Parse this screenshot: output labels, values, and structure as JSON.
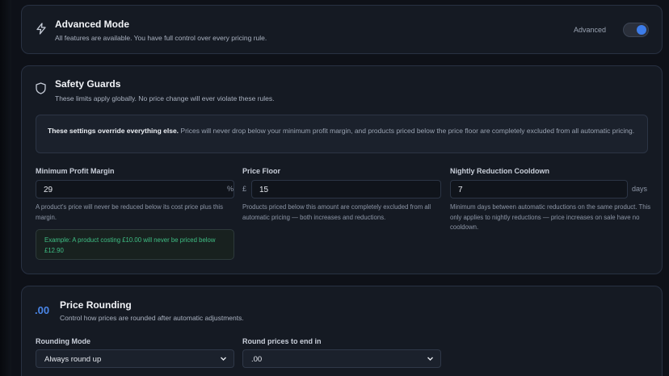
{
  "advanced": {
    "title": "Advanced Mode",
    "description": "All features are available. You have full control over every pricing rule.",
    "toggle_label": "Advanced",
    "toggle_on": true,
    "icon": "lightning-icon"
  },
  "safety": {
    "title": "Safety Guards",
    "description": "These limits apply globally. No price change will ever violate these rules.",
    "icon": "shield-icon",
    "notice_bold": "These settings override everything else.",
    "notice_text": " Prices will never drop below your minimum profit margin, and products priced below the price floor are completely excluded from all automatic pricing.",
    "fields": {
      "min_margin": {
        "label": "Minimum Profit Margin",
        "value": "29",
        "unit": "%",
        "help": "A product's price will never be reduced below its cost price plus this margin."
      },
      "price_floor": {
        "label": "Price Floor",
        "value": "15",
        "prefix": "£",
        "help": "Products priced below this amount are completely excluded from all automatic pricing — both increases and reductions."
      },
      "cooldown": {
        "label": "Nightly Reduction Cooldown",
        "value": "7",
        "unit": "days",
        "help": "Minimum days between automatic reductions on the same product. This only applies to nightly reductions — price increases on sale have no cooldown."
      }
    },
    "example": "Example: A product costing £10.00 will never be priced below £12.90"
  },
  "rounding": {
    "icon_text": ".00",
    "title": "Price Rounding",
    "description": "Control how prices are rounded after automatic adjustments.",
    "mode_label": "Rounding Mode",
    "mode_value": "Always round up",
    "end_label": "Round prices to end in",
    "end_value": ".00"
  }
}
